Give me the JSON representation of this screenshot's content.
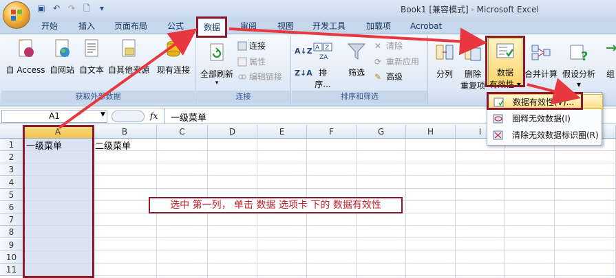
{
  "window": {
    "title": "Book1  [兼容模式] - Microsoft Excel"
  },
  "tabs": [
    "开始",
    "插入",
    "页面布局",
    "公式",
    "数据",
    "审阅",
    "视图",
    "开发工具",
    "加载项",
    "Acrobat"
  ],
  "active_tab": "数据",
  "ribbon": {
    "external": {
      "label": "获取外部数据",
      "buttons": [
        "自 Access",
        "自网站",
        "自文本",
        "自其他来源",
        "现有连接"
      ]
    },
    "connections": {
      "label": "连接",
      "refresh": "全部刷新",
      "items": [
        "连接",
        "属性",
        "编辑链接"
      ]
    },
    "sort": {
      "label": "排序和筛选",
      "sort_btn": "排序...",
      "filter_btn": "筛选",
      "items": [
        "清除",
        "重新应用",
        "高级"
      ]
    },
    "tools": {
      "split": "分列",
      "remove_dup_1": "删除",
      "remove_dup_2": "重复项",
      "validation_1": "数据",
      "validation_2": "有效性",
      "consolidate": "合并计算",
      "whatif": "假设分析",
      "group": "组"
    }
  },
  "formula_bar": {
    "name_box": "A1",
    "fx": "fx",
    "value": "一级菜单"
  },
  "grid": {
    "columns": [
      "A",
      "B",
      "C",
      "D",
      "E",
      "F",
      "G",
      "H",
      "I"
    ],
    "rows": [
      "1",
      "2",
      "3",
      "4",
      "5",
      "6",
      "7",
      "8",
      "9",
      "10",
      "11"
    ],
    "cells": {
      "A1": "一级菜单",
      "B1": "二级菜单"
    }
  },
  "dropdown": {
    "items": [
      "数据有效性(V)...",
      "圈释无效数据(I)",
      "清除无效数据标识圈(R)"
    ]
  },
  "annotation": {
    "note": "选中 第一列， 单击 数据 选项卡 下的  数据有效性"
  },
  "colors": {
    "annotation_red": "#8b1a2b",
    "arrow_red": "#e8373e"
  }
}
